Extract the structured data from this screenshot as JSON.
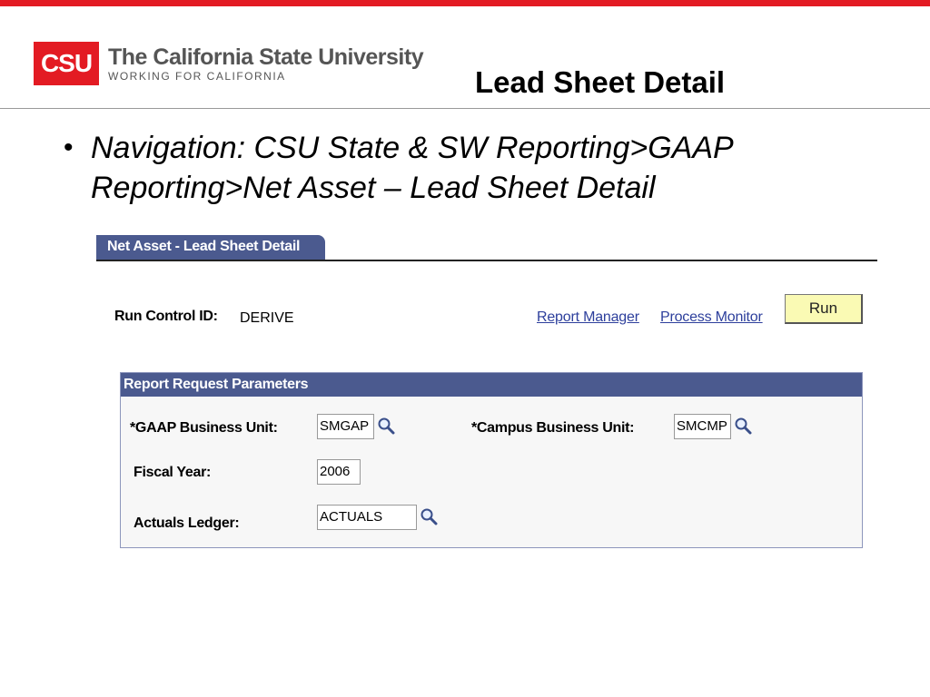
{
  "branding": {
    "logo_mark": "CSU",
    "logo_title": "The California State University",
    "logo_subtitle": "WORKING FOR CALIFORNIA",
    "accent_color": "#e31b23"
  },
  "slide": {
    "title": "Lead Sheet Detail",
    "bullet_text": "Navigation:  CSU State & SW Reporting>GAAP Reporting>Net Asset – Lead Sheet Detail"
  },
  "page": {
    "tab_label": "Net Asset - Lead Sheet Detail",
    "run_control_label": "Run Control ID:",
    "run_control_value": "DERIVE",
    "report_manager_link": "Report Manager",
    "process_monitor_link": "Process Monitor",
    "run_button_label": "Run"
  },
  "parameters": {
    "header": "Report Request Parameters",
    "gaap_bu_label": "*GAAP Business Unit:",
    "gaap_bu_value": "SMGAP",
    "campus_bu_label": "*Campus Business Unit:",
    "campus_bu_value": "SMCMP",
    "fiscal_year_label": "Fiscal Year:",
    "fiscal_year_value": "2006",
    "ledger_label": "Actuals Ledger:",
    "ledger_value": "ACTUALS"
  },
  "colors": {
    "header_blue": "#4b5a8f",
    "link_blue": "#2d3f9c",
    "run_button_bg": "#fafab4"
  },
  "icons": {
    "lookup": "magnifier-icon"
  }
}
